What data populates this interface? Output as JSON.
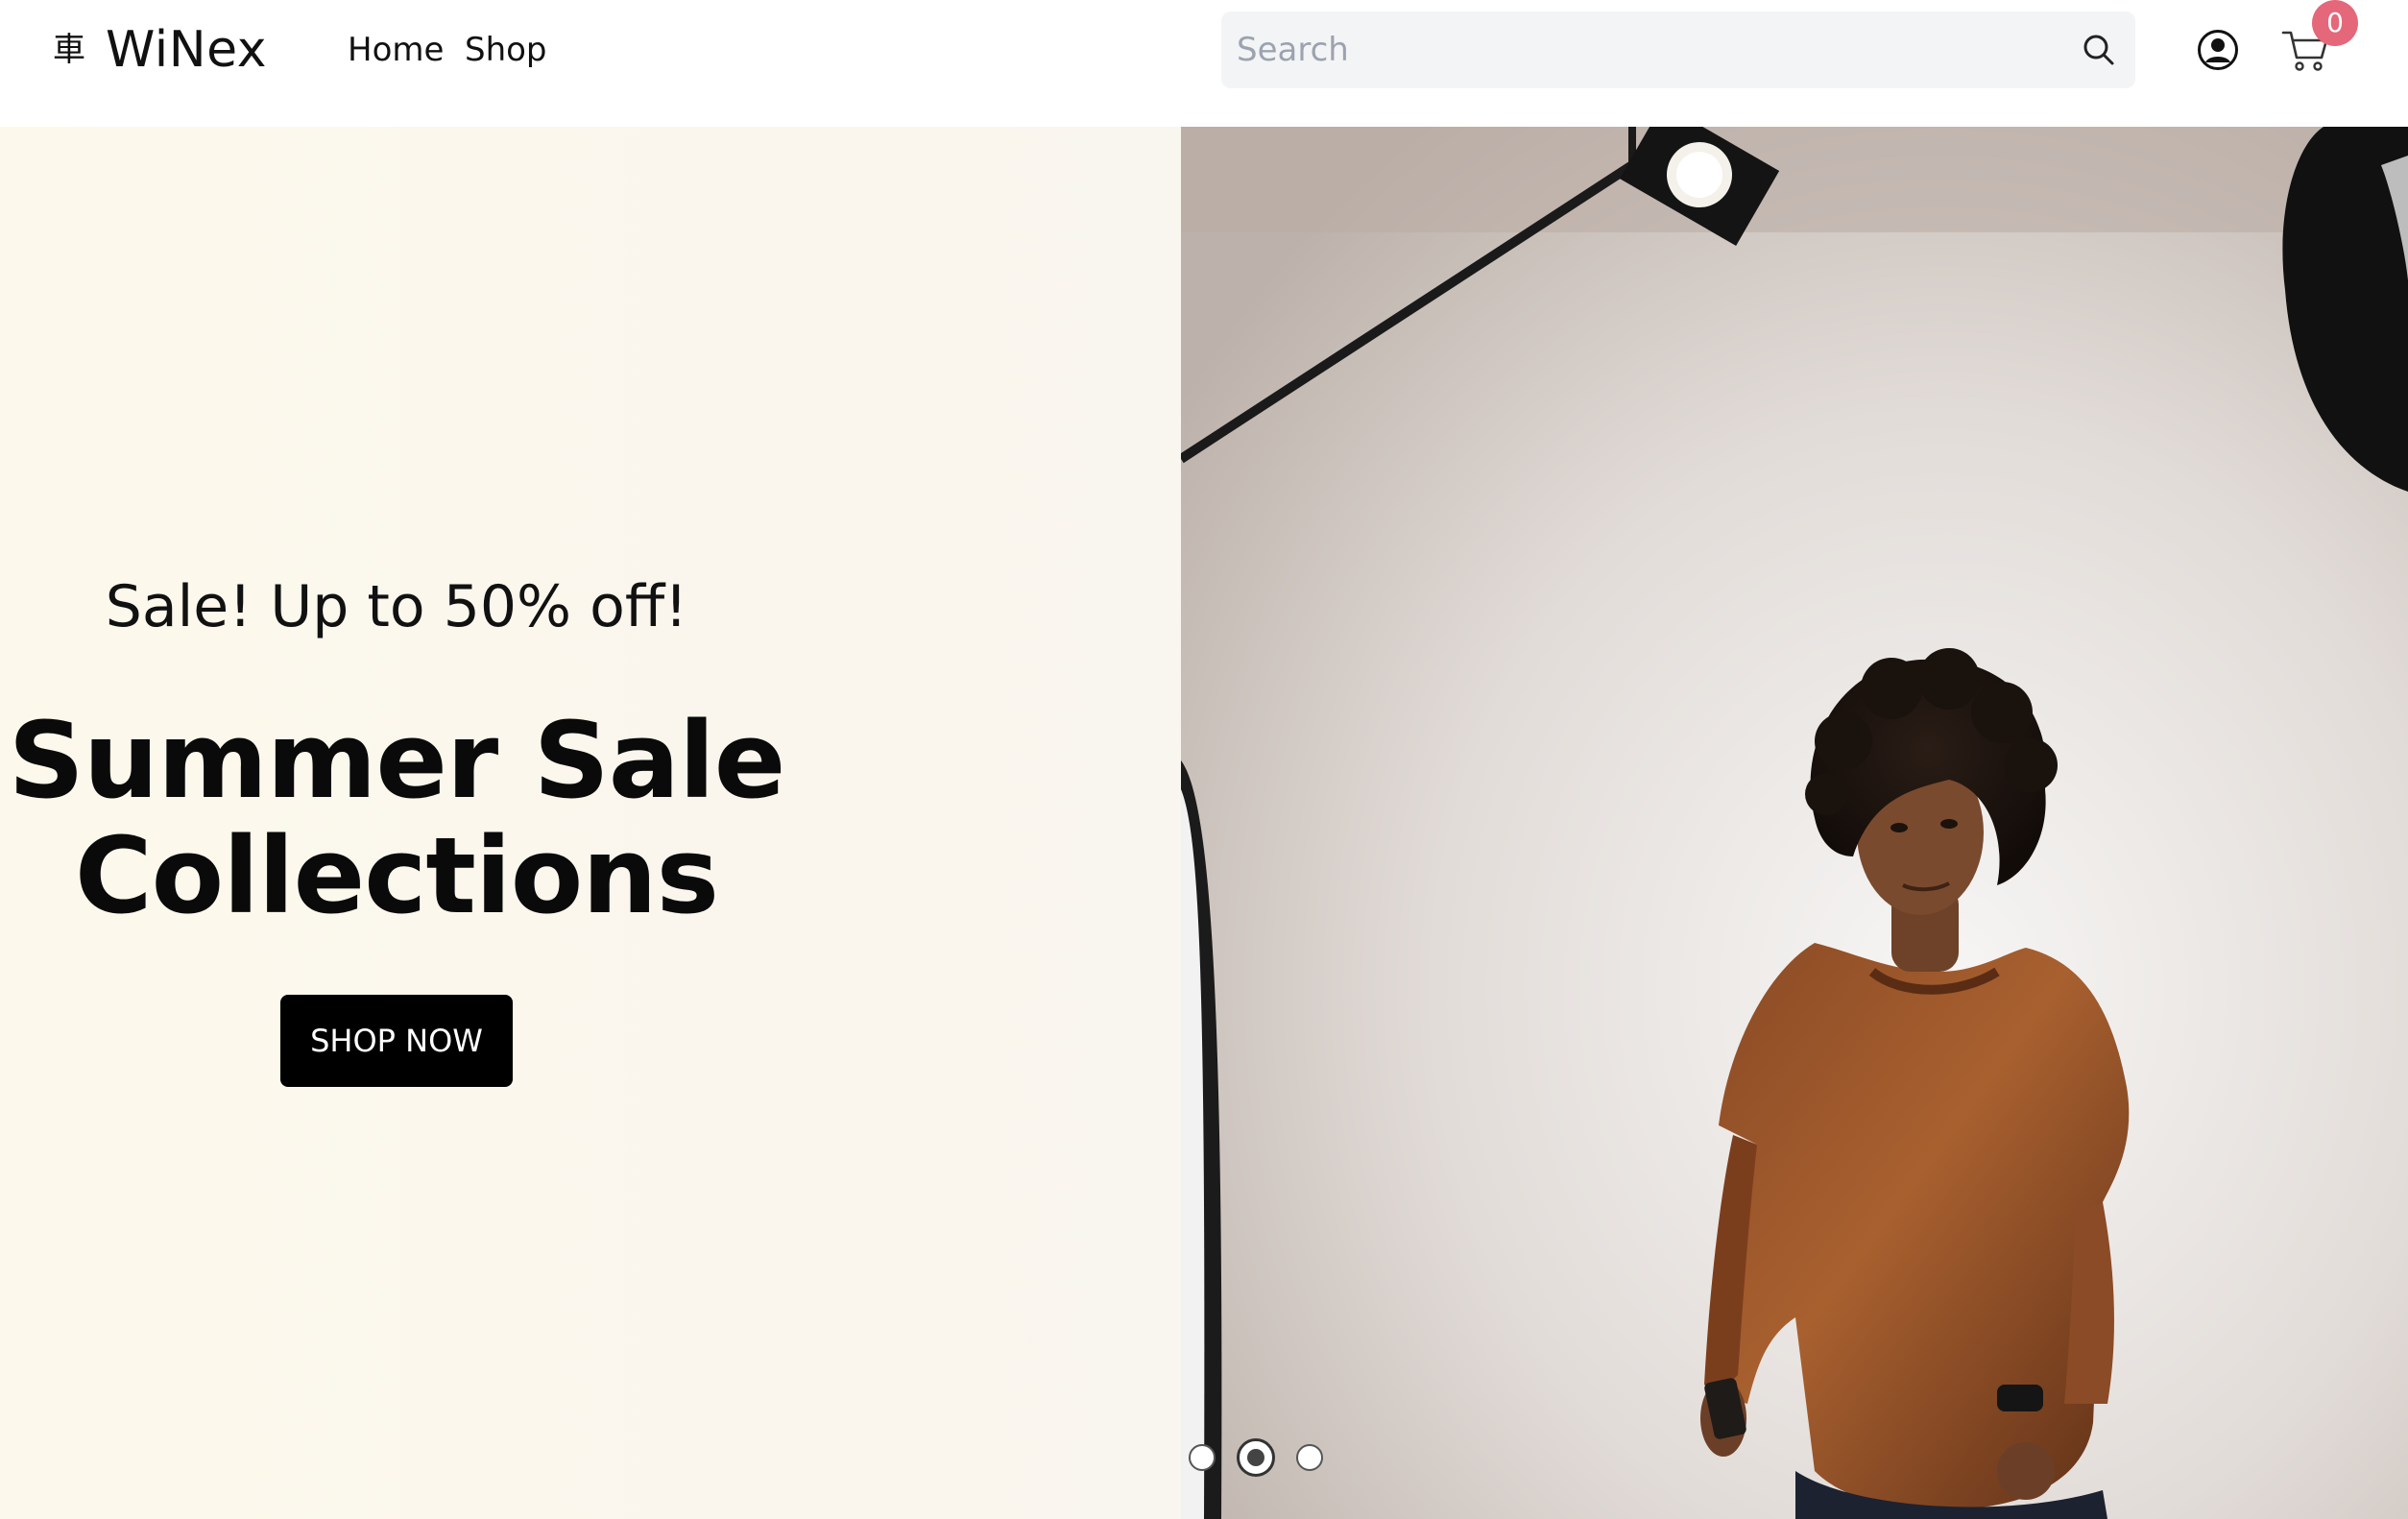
{
  "brand": {
    "mark": "車",
    "name": "WiNex"
  },
  "nav": {
    "home": "Home",
    "shop": "Shop"
  },
  "search": {
    "placeholder": "Search",
    "value": ""
  },
  "cart": {
    "count": "0",
    "badge_color": "#e5677a"
  },
  "icons": {
    "search": "search-icon",
    "account": "user-circle-icon",
    "cart": "shopping-cart-icon"
  },
  "hero": {
    "subtitle": "Sale! Up to 50% off!",
    "title": "Summer Sale\nCollections",
    "cta_label": "SHOP NOW",
    "background": "#fcf9ec",
    "cta_color": "#000000"
  },
  "carousel": {
    "slide_count": 3,
    "active_index": 1
  }
}
